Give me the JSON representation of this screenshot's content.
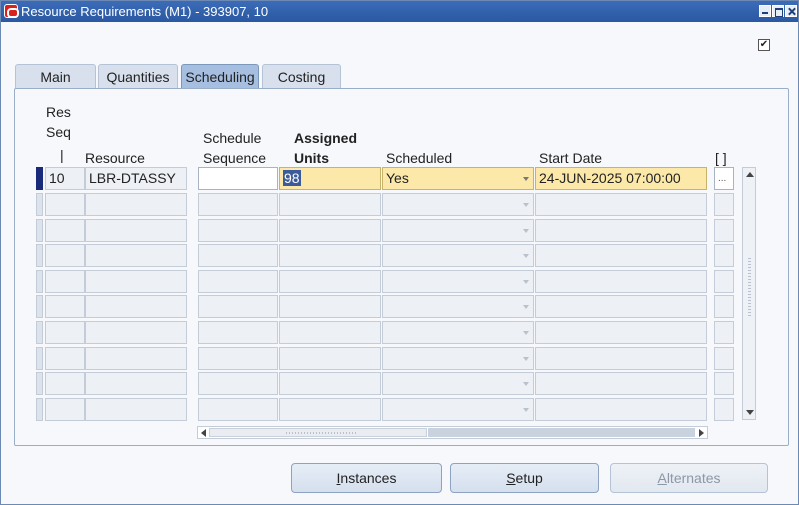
{
  "window": {
    "title": "Resource Requirements (M1) - 393907, 10"
  },
  "top_checkbox": {
    "checked": true,
    "glyph": "✔"
  },
  "tabs": [
    {
      "label": "Main",
      "active": false
    },
    {
      "label": "Quantities",
      "active": false
    },
    {
      "label": "Scheduling",
      "active": true
    },
    {
      "label": "Costing",
      "active": false
    }
  ],
  "columns": {
    "res_seq_line1": "Res",
    "res_seq_line2": "Seq",
    "res_seq_sep": "|",
    "resource": "Resource",
    "schedule_line1": "Schedule",
    "schedule_line2": "Sequence",
    "assigned_line1": "Assigned",
    "assigned_line2": "Units",
    "scheduled": "Scheduled",
    "start_date": "Start Date",
    "dff": "[ ]"
  },
  "rows": [
    {
      "res_seq": "10",
      "resource": "LBR-DTASSY",
      "schedule_sequence": "",
      "assigned_units": "98",
      "scheduled": "Yes",
      "start_date": "24-JUN-2025 07:00:00",
      "dff": "..."
    }
  ],
  "empty_rows": 9,
  "buttons": {
    "instances": {
      "mnemonic": "I",
      "rest": "nstances"
    },
    "setup": {
      "mnemonic": "S",
      "rest": "etup"
    },
    "alternates": {
      "mnemonic": "A",
      "rest": "lternates",
      "enabled": false
    }
  },
  "colors": {
    "titlebar": "#2a58a3",
    "active_tab": "#a6bedf",
    "required_field": "#fce9a9",
    "current_record_indicator": "#1a2a7a"
  }
}
